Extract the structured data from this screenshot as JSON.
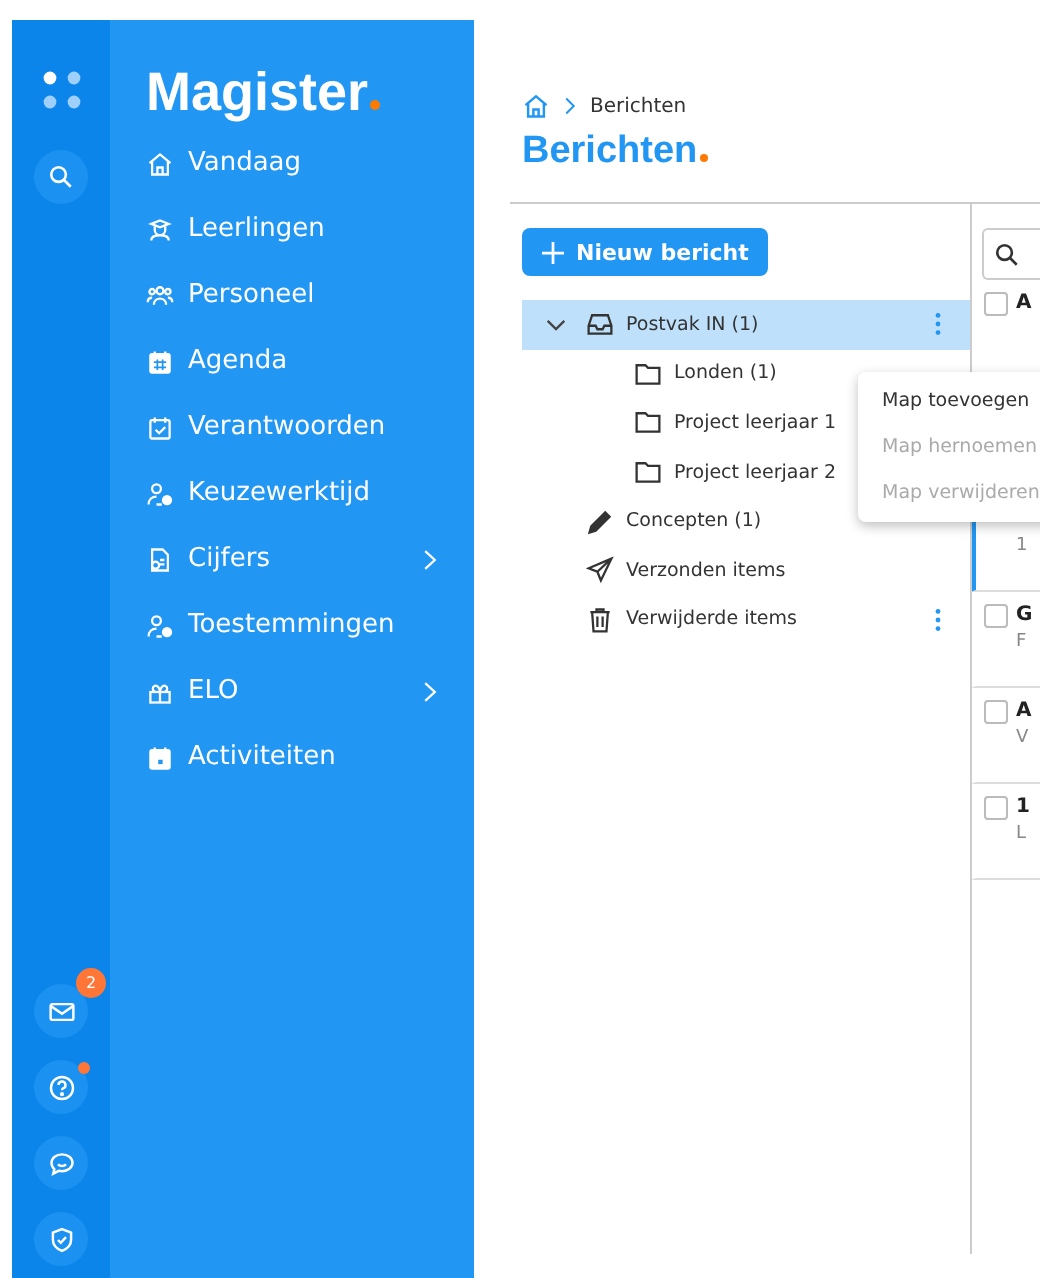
{
  "sidebar": {
    "logo": "Magister",
    "items": [
      {
        "label": "Vandaag",
        "has_submenu": false
      },
      {
        "label": "Leerlingen",
        "has_submenu": false
      },
      {
        "label": "Personeel",
        "has_submenu": false
      },
      {
        "label": "Agenda",
        "has_submenu": false
      },
      {
        "label": "Verantwoorden",
        "has_submenu": false
      },
      {
        "label": "Keuzewerktijd",
        "has_submenu": false
      },
      {
        "label": "Cijfers",
        "has_submenu": true
      },
      {
        "label": "Toestemmingen",
        "has_submenu": false
      },
      {
        "label": "ELO",
        "has_submenu": true
      },
      {
        "label": "Activiteiten",
        "has_submenu": false
      }
    ],
    "rail_buttons": [
      {
        "kind": "mail",
        "badge": "2"
      },
      {
        "kind": "help",
        "dot": true
      },
      {
        "kind": "chat",
        "dot": false
      },
      {
        "kind": "shield",
        "dot": false
      }
    ]
  },
  "breadcrumb": [
    "Berichten"
  ],
  "page_title": "Berichten",
  "new_button": "Nieuw bericht",
  "folders": [
    {
      "label": "Postvak IN (1)",
      "kind": "inbox",
      "selected": true,
      "expanded": true,
      "has_menu": true,
      "children": [
        {
          "label": "Londen (1)",
          "selected": false
        },
        {
          "label": "Project leerjaar 1",
          "selected": false
        },
        {
          "label": "Project leerjaar 2",
          "selected": false
        }
      ]
    },
    {
      "label": "Concepten (1)",
      "kind": "pencil",
      "selected": false,
      "has_menu": false
    },
    {
      "label": "Verzonden items",
      "kind": "send",
      "selected": false,
      "has_menu": false
    },
    {
      "label": "Verwijderde items",
      "kind": "trash",
      "selected": false,
      "has_menu": true
    }
  ],
  "context_menu": [
    {
      "label": "Map toevoegen",
      "disabled": false
    },
    {
      "label": "Map hernoemen",
      "disabled": true
    },
    {
      "label": "Map verwijderen",
      "disabled": true
    }
  ],
  "messages": [
    {
      "title": "A",
      "checked": false,
      "selected": false
    },
    {
      "subtitle": "1",
      "selected": true
    },
    {
      "title": "G",
      "subtitle": "F",
      "checked": false,
      "selected": false
    },
    {
      "title": "A",
      "subtitle": "V",
      "checked": false,
      "selected": false
    },
    {
      "title": "1",
      "subtitle": "L",
      "checked": false,
      "selected": false
    }
  ]
}
